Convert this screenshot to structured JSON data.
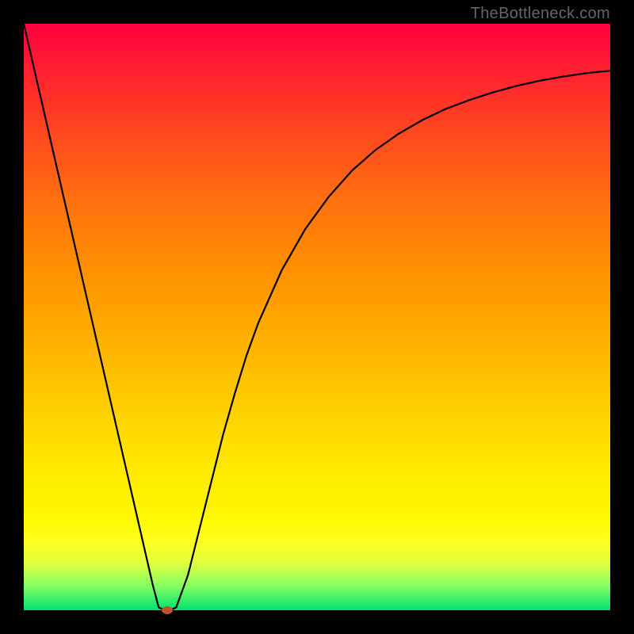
{
  "attribution": "TheBottleneck.com",
  "chart_data": {
    "type": "line",
    "title": "",
    "xlabel": "",
    "ylabel": "",
    "xlim": [
      0,
      100
    ],
    "ylim": [
      0,
      100
    ],
    "x": [
      0,
      2,
      4,
      6,
      8,
      10,
      12,
      14,
      16,
      18,
      20,
      22,
      23,
      24,
      25,
      26,
      28,
      30,
      32,
      34,
      36,
      38,
      40,
      44,
      48,
      52,
      56,
      60,
      64,
      68,
      72,
      76,
      80,
      84,
      88,
      92,
      96,
      100
    ],
    "values": [
      100,
      91.3,
      82.6,
      73.9,
      65.2,
      56.5,
      47.8,
      39.1,
      30.4,
      21.7,
      13.0,
      4.3,
      0.5,
      0,
      0,
      0.5,
      6,
      14,
      22,
      30,
      37,
      43.5,
      49,
      58,
      65,
      70.5,
      75,
      78.5,
      81.3,
      83.6,
      85.5,
      87,
      88.3,
      89.4,
      90.3,
      91,
      91.6,
      92
    ],
    "marker": {
      "x": 24.5,
      "y": 0
    },
    "background_gradient": {
      "top": "#ff0040",
      "bottom": "#00e070"
    }
  },
  "ui": {
    "plot_area_name": "bottleneck-plot",
    "curve_name": "bottleneck-curve",
    "marker_name": "optimal-point-marker"
  }
}
